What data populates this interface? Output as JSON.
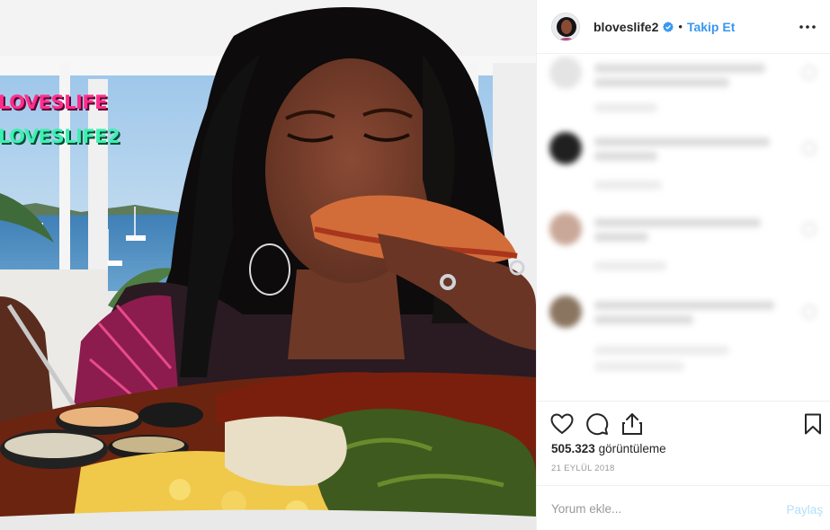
{
  "media": {
    "overlay_line_1": "LOVESLIFE",
    "overlay_line_2": "LOVESLIFE2"
  },
  "header": {
    "username": "bloveslife2",
    "dot": "•",
    "follow_label": "Takip Et",
    "verified_color": "#3897f0"
  },
  "comments": [
    {
      "avatar_color": "#e4e4e4"
    },
    {
      "avatar_color": "#202020"
    },
    {
      "avatar_color": "#c9a898"
    },
    {
      "avatar_color": "#8a7560"
    }
  ],
  "actions": {
    "like_icon": "heart-icon",
    "comment_icon": "comment-icon",
    "share_icon": "share-icon",
    "save_icon": "bookmark-icon"
  },
  "stats": {
    "views_count": "505.323",
    "views_label": " görüntüleme",
    "date": "21 EYLÜL 2018"
  },
  "add_comment": {
    "placeholder": "Yorum ekle...",
    "post_label": "Paylaş"
  },
  "colors": {
    "accent": "#3897f0",
    "post_disabled": "#b2dffc",
    "muted": "#999999"
  }
}
